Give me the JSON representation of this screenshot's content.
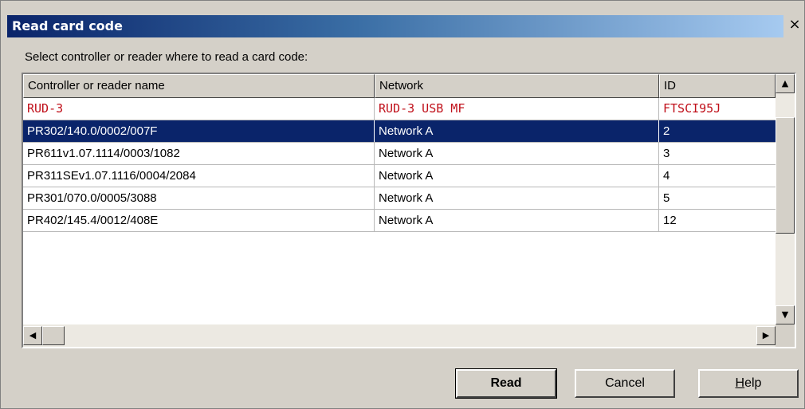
{
  "window": {
    "title": "Read card code",
    "close_glyph": "×"
  },
  "prompt": "Select controller or reader where to read a card code:",
  "table": {
    "columns": [
      "Controller or reader name",
      "Network",
      "ID"
    ],
    "rows": [
      {
        "name": "RUD-3",
        "network": "RUD-3 USB MF",
        "id": "FTSCI95J",
        "style": "red"
      },
      {
        "name": "PR302/140.0/0002/007F",
        "network": "Network A",
        "id": "2",
        "style": "selected"
      },
      {
        "name": "PR611v1.07.1114/0003/1082",
        "network": "Network A",
        "id": "3",
        "style": ""
      },
      {
        "name": "PR311SEv1.07.1116/0004/2084",
        "network": "Network A",
        "id": "4",
        "style": ""
      },
      {
        "name": "PR301/070.0/0005/3088",
        "network": "Network A",
        "id": "5",
        "style": ""
      },
      {
        "name": "PR402/145.4/0012/408E",
        "network": "Network A",
        "id": "12",
        "style": ""
      }
    ],
    "scroll_glyphs": {
      "up": "▲",
      "down": "▼",
      "left": "◀",
      "right": "▶"
    }
  },
  "buttons": {
    "read": "Read",
    "cancel": "Cancel",
    "help_mnemonic": "H",
    "help_rest": "elp"
  },
  "colors": {
    "title_start": "#0a246a",
    "title_end": "#a6caf0",
    "selected_row": "#0a246a",
    "red_row_text": "#c0101a",
    "face": "#d4d0c8"
  }
}
